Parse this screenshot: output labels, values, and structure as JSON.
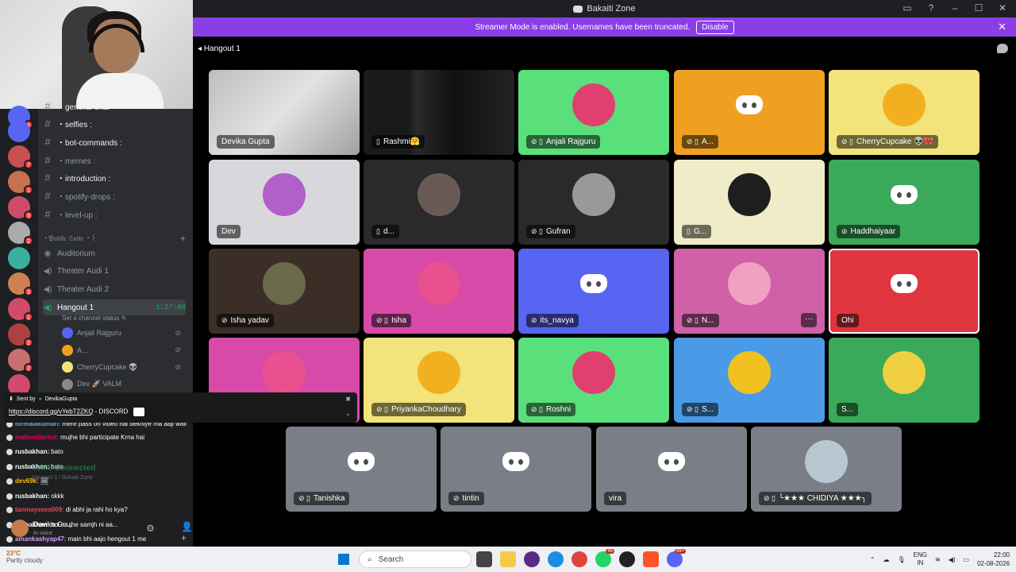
{
  "window": {
    "title": "Bakaiti Zone",
    "controls": [
      "▭",
      "?",
      "–",
      "☐",
      "✕"
    ]
  },
  "streamer_banner": {
    "text": "Streamer Mode is enabled. Usernames have been truncated.",
    "button": "Disable",
    "close": "✕"
  },
  "stage": {
    "channel_name": "Hangout 1"
  },
  "tiles": [
    {
      "name": "Devika Gupta",
      "bg": "#c9c9c9",
      "kind": "video",
      "mute": ""
    },
    {
      "name": "Rashmi🤗",
      "bg": "#1f1f1f",
      "kind": "video-dark",
      "mute": "▯"
    },
    {
      "name": "Anjali Rajguru",
      "bg": "#5ae07a",
      "kind": "avatar-house",
      "mute": "⊘ ▯"
    },
    {
      "name": "A...",
      "bg": "#f0a020",
      "kind": "discord",
      "mute": "⊘ ▯"
    },
    {
      "name": "CherryCupcake 👽🎀",
      "bg": "#f2e47a",
      "kind": "avatar-yellow",
      "mute": "⊘ ▯"
    },
    {
      "name": "Dev",
      "bg": "#d8d8dc",
      "kind": "avatar-dev",
      "mute": ""
    },
    {
      "name": "d...",
      "bg": "#2a2a2a",
      "kind": "avatar-photo",
      "mute": "▯"
    },
    {
      "name": "Gufran",
      "bg": "#2a2a2a",
      "kind": "avatar-bw",
      "mute": "⊘ ▯"
    },
    {
      "name": "G...",
      "bg": "#f0ecc8",
      "kind": "avatar-flower",
      "mute": "▯"
    },
    {
      "name": "Haddhaiyaar",
      "bg": "#3aaa5a",
      "kind": "discord",
      "mute": "⊘"
    },
    {
      "name": "Isha yadav",
      "bg": "#3a2e26",
      "kind": "avatar-photo2",
      "mute": "⊘"
    },
    {
      "name": "Isha",
      "bg": "#d84aa8",
      "kind": "avatar-pink",
      "mute": "⊘ ▯"
    },
    {
      "name": "its_navya",
      "bg": "#5865f2",
      "kind": "discord",
      "mute": "⊘"
    },
    {
      "name": "N...",
      "bg": "#d060a8",
      "kind": "avatar-n",
      "mute": "⊘ ▯",
      "more": "···"
    },
    {
      "name": "Ohi",
      "bg": "#e0353f",
      "kind": "discord",
      "mute": "",
      "speaking": true
    },
    {
      "name": "",
      "bg": "#d84aa8",
      "kind": "avatar-pink",
      "mute": ""
    },
    {
      "name": "PriyankaChoudhary",
      "bg": "#f2e47a",
      "kind": "avatar-yellow",
      "mute": "⊘ ▯"
    },
    {
      "name": "Roshni",
      "bg": "#5ae07a",
      "kind": "avatar-house",
      "mute": "⊘ ▯"
    },
    {
      "name": "S...",
      "bg": "#4a9ae8",
      "kind": "avatar-blue",
      "mute": "⊘ ▯"
    },
    {
      "name": "S...",
      "bg": "#3aaa5a",
      "kind": "avatar-green",
      "mute": ""
    },
    {
      "name": "Tanishka",
      "bg": "#7a7e86",
      "kind": "discord",
      "mute": "⊘ ▯"
    },
    {
      "name": "tintin",
      "bg": "#7a7e86",
      "kind": "discord",
      "mute": "⊘"
    },
    {
      "name": "vira",
      "bg": "#7a7e86",
      "kind": "discord",
      "mute": ""
    },
    {
      "name": "╰★★★ CHIDIYA ★★★╮",
      "bg": "#7a7e86",
      "kind": "avatar-tree",
      "mute": "⊘ ▯"
    }
  ],
  "call_controls": {
    "mic": "🎙",
    "mic_menu": "⌄",
    "camera": "■",
    "camera_menu": "⌄",
    "screen_share": "⬚",
    "activities": "✥",
    "soundboard": "✺",
    "more": "···",
    "hangup": "☎",
    "popout": "⬈",
    "fullscreen": "⛶"
  },
  "channels": [
    {
      "icon": "#",
      "label": "・general-chat",
      "unread": true
    },
    {
      "icon": "#",
      "label": "・selfies :",
      "unread": true
    },
    {
      "icon": "#",
      "label": "・bot-commands :",
      "unread": true
    },
    {
      "icon": "#",
      "label": "・memes :",
      "unread": false
    },
    {
      "icon": "#",
      "label": "・introduction :",
      "unread": true
    },
    {
      "icon": "#",
      "label": "・spotify-drops :",
      "unread": false
    },
    {
      "icon": "#",
      "label": "・level-up :",
      "unread": false
    }
  ],
  "category": {
    "label": "・𝔓𝔲𝔟𝔩𝔦𝔠 𝔖𝔲𝔦𝔱𝔢 ・꒰",
    "plus": "+"
  },
  "voice_channels": [
    {
      "icon": "◉",
      "label": "Auditorium"
    },
    {
      "icon": "◀)",
      "label": "Theater Audi 1"
    },
    {
      "icon": "◀)",
      "label": "Theater Audi 2"
    },
    {
      "icon": "◀)",
      "label": "Hangout 1",
      "timer": "1:27:00",
      "active": true
    }
  ],
  "channel_status": "Set a channel status ✎",
  "voice_users": [
    {
      "name": "Anjali Rajguru",
      "color": "#5865f2",
      "mute": "⊘"
    },
    {
      "name": "A...",
      "color": "#f0a020",
      "mute": "⊘"
    },
    {
      "name": "CherryCupcake 👽",
      "color": "#f2e47a",
      "mute": "⊘"
    },
    {
      "name": "Dev 🚀 VALM",
      "color": "#888",
      "mute": ""
    }
  ],
  "server_badges": [
    "4",
    "",
    "7",
    "1",
    "3",
    "2",
    "",
    "3",
    "1",
    "2",
    "2",
    ""
  ],
  "sent_by": {
    "prefix": "Sent by",
    "user": "DevikaGupta",
    "link": "https://discord.gg/vYebT2ZKQ",
    "suffix": "- DISCORD"
  },
  "chat_messages": [
    {
      "user": "nirmalakumari:",
      "color": "#6ad",
      "text": "mere pass on video hai dekhiye ma aaji wali"
    },
    {
      "user": "mahendiartist:",
      "color": "#e06",
      "text": "mujhe bhi participate Krna hai"
    },
    {
      "user": "rusbakhan:",
      "color": "#fff",
      "text": "bato"
    },
    {
      "user": "rusbakhan:",
      "color": "#fff",
      "text": "bato"
    },
    {
      "user": "dev69k:",
      "color": "#fb0",
      "text": "🖼"
    },
    {
      "user": "rusbakhan:",
      "color": "#fff",
      "text": "okkk"
    },
    {
      "user": "tanmaysees009:",
      "color": "#e45",
      "text": "di abhi ja rahi ho kya?"
    },
    {
      "user": "rusbakhan:",
      "color": "#fff",
      "text": "bol mujhe samjh ni aa..."
    },
    {
      "user": "amankashyap47:",
      "color": "#d9f",
      "text": "main bhi aajo hengout 1 me"
    }
  ],
  "voice_panel": {
    "status": "Voice Connected",
    "sub": "Hangout 1 / Bakaiti Zone",
    "user": "Devika Gu...",
    "in_voice": "In voice",
    "gear": "⚙",
    "add_friend": "👤+"
  },
  "taskbar": {
    "weather_line1": "23°C",
    "weather_line2": "Partly cloudy",
    "search_placeholder": "Search",
    "lang_top": "ENG",
    "lang_bottom": "IN",
    "time": "22:00",
    "date": "02-08-2026",
    "badge_whatsapp": "46",
    "badge_discord": "99+"
  }
}
